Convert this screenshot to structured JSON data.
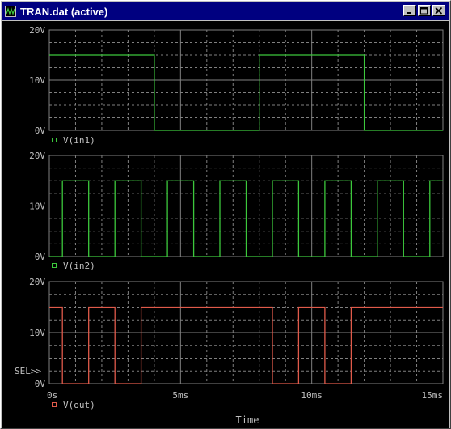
{
  "window": {
    "title": "TRAN.dat (active)",
    "icon": "probe-app-icon",
    "controls": [
      "minimize-icon",
      "maximize-icon",
      "close-icon"
    ]
  },
  "colors": {
    "title_bg": "#000080",
    "background": "#000000",
    "grid": "#808080",
    "axis_text": "#c0c0c0",
    "trace_green": "#3cc83c",
    "trace_red": "#e05a4a"
  },
  "xaxis": {
    "label": "Time",
    "min_ms": 0,
    "max_ms": 15,
    "ticks": [
      {
        "value": 0,
        "label": "0s"
      },
      {
        "value": 5,
        "label": "5ms"
      },
      {
        "value": 10,
        "label": "10ms"
      },
      {
        "value": 15,
        "label": "15ms"
      }
    ]
  },
  "sel_marker": "SEL>>",
  "chart_data": [
    {
      "type": "line",
      "ylim": [
        0,
        20
      ],
      "ticks": [
        {
          "value": 0,
          "label": "0V"
        },
        {
          "value": 10,
          "label": "10V"
        },
        {
          "value": 20,
          "label": "20V"
        }
      ],
      "series": [
        {
          "name": "V(in1)",
          "color": "#3cc83c",
          "x": [
            0,
            4,
            4,
            8,
            8,
            12,
            12,
            15
          ],
          "y": [
            15,
            15,
            0,
            0,
            15,
            15,
            0,
            0
          ]
        }
      ]
    },
    {
      "type": "line",
      "ylim": [
        0,
        20
      ],
      "ticks": [
        {
          "value": 0,
          "label": "0V"
        },
        {
          "value": 10,
          "label": "10V"
        },
        {
          "value": 20,
          "label": "20V"
        }
      ],
      "series": [
        {
          "name": "V(in2)",
          "color": "#3cc83c",
          "x": [
            0,
            0.5,
            0.5,
            1.5,
            1.5,
            2.5,
            2.5,
            3.5,
            3.5,
            4.5,
            4.5,
            5.5,
            5.5,
            6.5,
            6.5,
            7.5,
            7.5,
            8.5,
            8.5,
            9.5,
            9.5,
            10.5,
            10.5,
            11.5,
            11.5,
            12.5,
            12.5,
            13.5,
            13.5,
            14.5,
            14.5,
            15
          ],
          "y": [
            0,
            0,
            15,
            15,
            0,
            0,
            15,
            15,
            0,
            0,
            15,
            15,
            0,
            0,
            15,
            15,
            0,
            0,
            15,
            15,
            0,
            0,
            15,
            15,
            0,
            0,
            15,
            15,
            0,
            0,
            15,
            15
          ]
        }
      ]
    },
    {
      "type": "line",
      "ylim": [
        0,
        20
      ],
      "ticks": [
        {
          "value": 0,
          "label": "0V"
        },
        {
          "value": 10,
          "label": "10V"
        },
        {
          "value": 20,
          "label": "20V"
        }
      ],
      "series": [
        {
          "name": "V(out)",
          "color": "#e05a4a",
          "x": [
            0,
            0.5,
            0.5,
            1.5,
            1.5,
            2.5,
            2.5,
            3.5,
            3.5,
            8.5,
            8.5,
            9.5,
            9.5,
            10.5,
            10.5,
            11.5,
            11.5,
            15
          ],
          "y": [
            15,
            15,
            0,
            0,
            15,
            15,
            0,
            0,
            15,
            15,
            0,
            0,
            15,
            15,
            0,
            0,
            15,
            15
          ]
        }
      ]
    }
  ]
}
